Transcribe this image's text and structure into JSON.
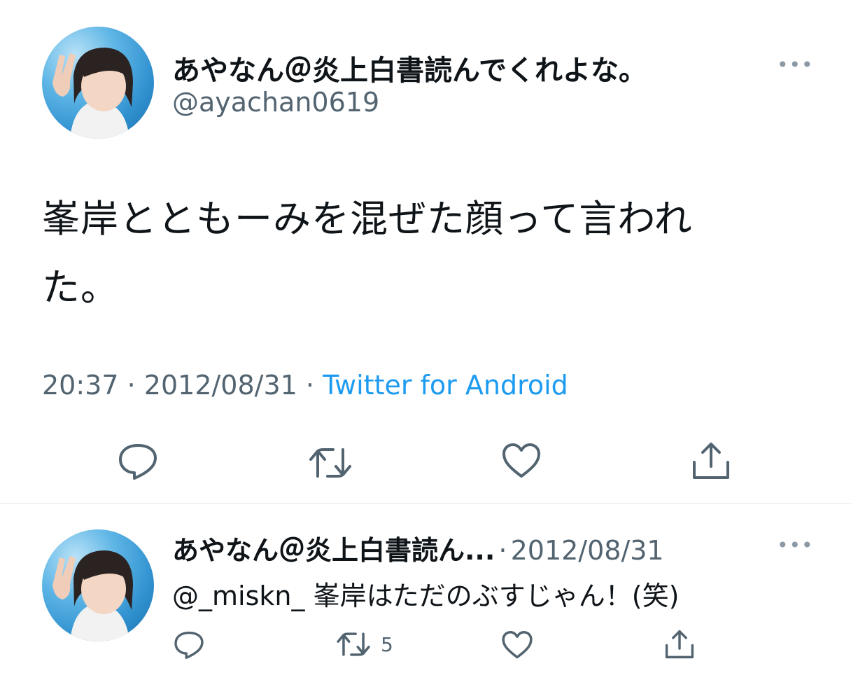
{
  "tweet": {
    "display_name": "あやなん＠炎上白書読んでくれよな。",
    "handle": "@ayachan0619",
    "text_line1": "峯岸とともーみを混ぜた顔って言われ",
    "text_line2": "た。",
    "time": "20:37",
    "date": "2012/08/31",
    "sep": "·",
    "source": "Twitter for Android",
    "more_label": "•••"
  },
  "reply": {
    "display_name": "あやなん＠炎上白書読ん...",
    "sep": "·",
    "date": "2012/08/31",
    "mention": "@_miskn_",
    "text": "峯岸はただのぶすじゃん！(笑)",
    "retweet_count": "5",
    "more_label": "•••"
  },
  "colors": {
    "text": "#0f1419",
    "secondary": "#536471",
    "link": "#1d9bf0",
    "divider": "#eff3f4"
  },
  "icons": {
    "reply": "reply-icon",
    "retweet": "retweet-icon",
    "like": "heart-icon",
    "share": "share-icon",
    "more": "more-icon"
  }
}
